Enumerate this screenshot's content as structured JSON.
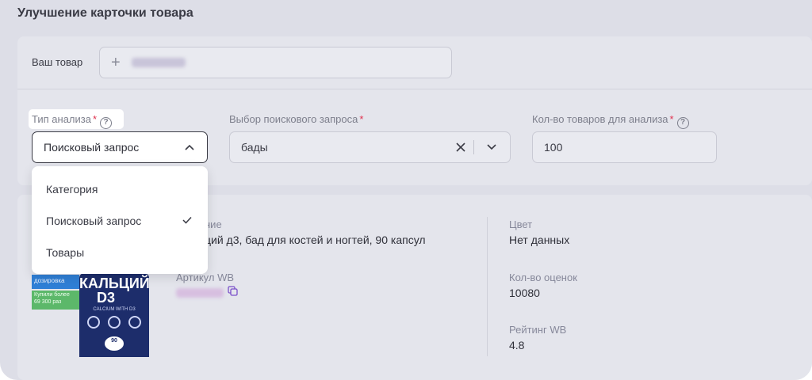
{
  "page": {
    "title": "Улучшение карточки товара"
  },
  "your_product": {
    "label": "Ваш товар",
    "add_symbol": "+"
  },
  "analysis_type": {
    "label": "Тип анализа",
    "required_mark": "*",
    "help": "?",
    "selected": "Поисковый запрос",
    "options": [
      "Категория",
      "Поисковый запрос",
      "Товары"
    ]
  },
  "search_query": {
    "label": "Выбор поискового запроса",
    "required_mark": "*",
    "value": "бады"
  },
  "count": {
    "label": "Кол-во товаров для анализа",
    "required_mark": "*",
    "help": "?",
    "value": "100"
  },
  "product": {
    "name_label": "ние",
    "name_value": "ций д3, бад для костей и ногтей, 90 капсул",
    "article_label": "Артикул WB",
    "color_label": "Цвет",
    "color_value": "Нет данных",
    "reviews_label": "Кол-во оценок",
    "reviews_value": "10080",
    "rating_label": "Рейтинг WB",
    "rating_value": "4.8",
    "image_text": {
      "brand": "КАЛЬЦИЙ",
      "brand2": "D3",
      "sub": "CALCIUM WITH D3",
      "badge1": "дозировка",
      "badge2a": "Купили более",
      "badge2b": "69 300 раз",
      "count": "90"
    }
  },
  "colors": {
    "background": "#dddee7",
    "panel": "#e4e5ec",
    "accent_required": "#e0324e",
    "bottle": "#1d2d6b",
    "badge_green": "#5cb86a",
    "badge_blue": "#2f7fd6"
  }
}
